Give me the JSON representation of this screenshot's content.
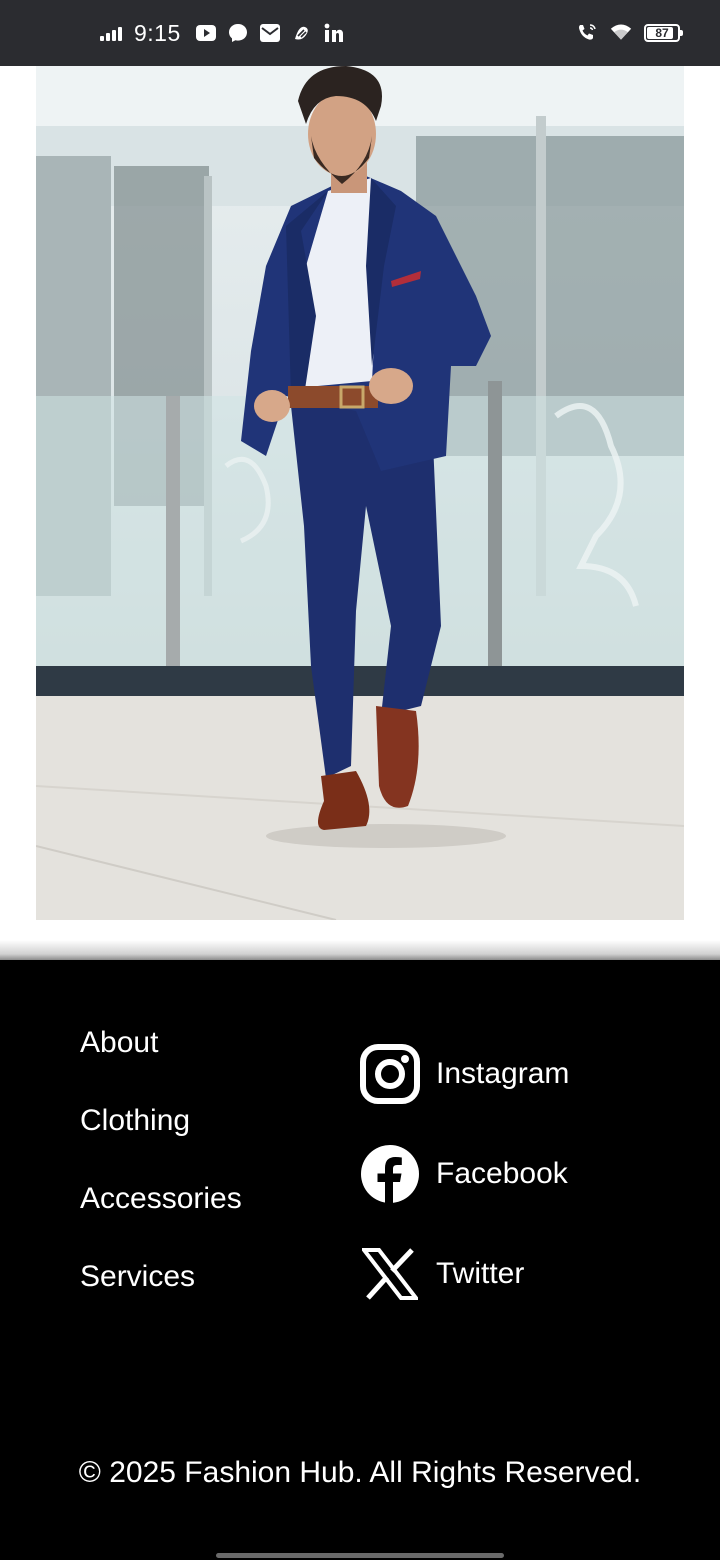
{
  "status_bar": {
    "time": "9:15",
    "battery": "87",
    "icons": [
      "signal-icon",
      "youtube-icon",
      "messenger-icon",
      "mail-icon",
      "app-icon",
      "linkedin-icon",
      "wifi-call-icon",
      "wifi-icon",
      "battery-icon"
    ]
  },
  "hero": {
    "image": "man-in-navy-suit-photo"
  },
  "footer": {
    "links": [
      "About",
      "Clothing",
      "Accessories",
      "Services"
    ],
    "socials": [
      {
        "label": "Instagram",
        "icon": "instagram-icon"
      },
      {
        "label": "Facebook",
        "icon": "facebook-icon"
      },
      {
        "label": "Twitter",
        "icon": "x-icon"
      }
    ],
    "copyright": "© 2025 Fashion Hub. All Rights Reserved."
  },
  "colors": {
    "status_bar_bg": "#2b2c30",
    "footer_bg": "#000000",
    "footer_text": "#ffffff",
    "suit": "#1e2f6e"
  }
}
